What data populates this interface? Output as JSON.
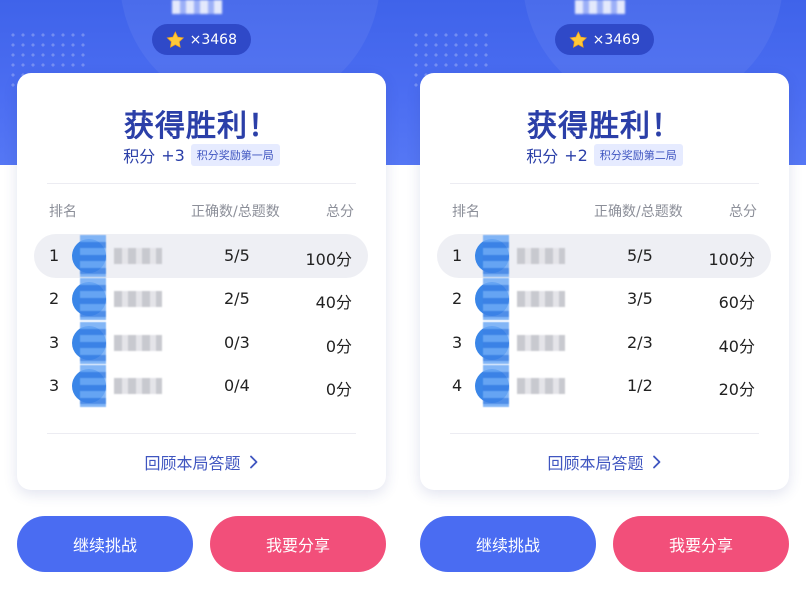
{
  "panels": [
    {
      "coins": "×3468",
      "title": "获得胜利！",
      "points_label": "积分",
      "points_value": "+3",
      "bonus_tag": "积分奖励第一局",
      "headers": {
        "rank": "排名",
        "ratio": "正确数/总题数",
        "total": "总分"
      },
      "rows": [
        {
          "rank": "1",
          "ratio": "5/5",
          "total": "100分"
        },
        {
          "rank": "2",
          "ratio": "2/5",
          "total": "40分"
        },
        {
          "rank": "3",
          "ratio": "0/3",
          "total": "0分"
        },
        {
          "rank": "3",
          "ratio": "0/4",
          "total": "0分"
        }
      ],
      "review": "回顾本局答题",
      "continue_btn": "继续挑战",
      "share_btn": "我要分享"
    },
    {
      "coins": "×3469",
      "title": "获得胜利！",
      "points_label": "积分",
      "points_value": "+2",
      "bonus_tag": "积分奖励第二局",
      "headers": {
        "rank": "排名",
        "ratio": "正确数/总题数",
        "total": "总分"
      },
      "rows": [
        {
          "rank": "1",
          "ratio": "5/5",
          "total": "100分"
        },
        {
          "rank": "2",
          "ratio": "3/5",
          "total": "60分"
        },
        {
          "rank": "3",
          "ratio": "2/3",
          "total": "40分"
        },
        {
          "rank": "4",
          "ratio": "1/2",
          "total": "20分"
        }
      ],
      "review": "回顾本局答题",
      "continue_btn": "继续挑战",
      "share_btn": "我要分享"
    }
  ],
  "colors": {
    "primary": "#4a6cf2",
    "accent": "#f24f7a",
    "title": "#2b3fa8"
  },
  "icons": {
    "coin": "star-icon",
    "review_arrow": "chevron-right-icon"
  }
}
